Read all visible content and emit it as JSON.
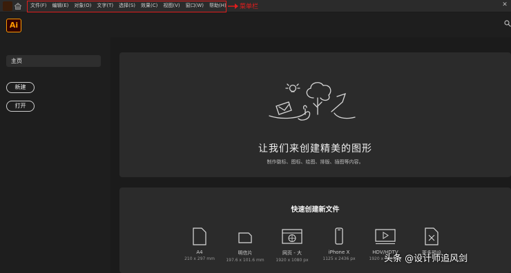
{
  "menu": [
    "文件(F)",
    "编辑(E)",
    "对象(O)",
    "文字(T)",
    "选择(S)",
    "效果(C)",
    "视图(V)",
    "窗口(W)",
    "帮助(H)"
  ],
  "annotation": "菜单栏",
  "app_logo": "Ai",
  "sidebar": {
    "home": "主页",
    "new_button": "新建",
    "open_button": "打开"
  },
  "hero": {
    "title": "让我们来创建精美的图形",
    "subtitle": "制作徽标、图标、绘图、排版、插图等内容。"
  },
  "quick_create": {
    "title": "快速创建新文件",
    "presets": [
      {
        "name": "A4",
        "size": "210 x 297 mm"
      },
      {
        "name": "明信片",
        "size": "197.6 x 101.6 mm"
      },
      {
        "name": "网页 - 大",
        "size": "1920 x 1080 px"
      },
      {
        "name": "iPhone X",
        "size": "1125 x 2436 px"
      },
      {
        "name": "HDV/HDTV",
        "size": "1920 x 1080 px"
      },
      {
        "name": "更多预设",
        "size": ""
      }
    ]
  },
  "watermark": "头条 @设计师追风剑",
  "colors": {
    "accent_red": "#e11d1d",
    "ai_orange": "#ff9a00",
    "ai_bg": "#330000"
  }
}
